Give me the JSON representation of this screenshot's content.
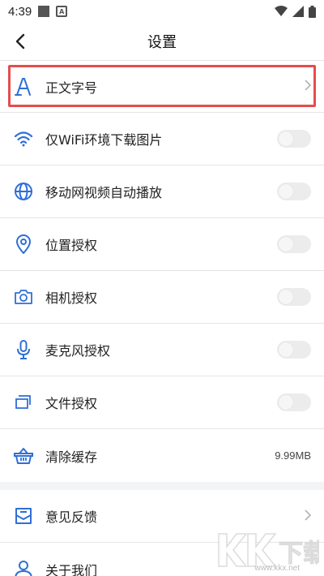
{
  "status_bar": {
    "time": "4:39",
    "app_icon_letter": "A",
    "icons": [
      "square-icon",
      "app-icon",
      "wifi-icon",
      "signal-icon",
      "battery-icon"
    ]
  },
  "nav": {
    "title": "设置"
  },
  "settings": [
    {
      "label": "正文字号",
      "icon": "font-size-icon",
      "control": "chevron"
    },
    {
      "label": "仅WiFi环境下载图片",
      "icon": "wifi-icon",
      "control": "toggle",
      "on": false
    },
    {
      "label": "移动网视频自动播放",
      "icon": "globe-icon",
      "control": "toggle",
      "on": false
    },
    {
      "label": "位置授权",
      "icon": "location-pin-icon",
      "control": "toggle",
      "on": false
    },
    {
      "label": "相机授权",
      "icon": "camera-icon",
      "control": "toggle",
      "on": false
    },
    {
      "label": "麦克风授权",
      "icon": "microphone-icon",
      "control": "toggle",
      "on": false
    },
    {
      "label": "文件授权",
      "icon": "folder-icon",
      "control": "toggle",
      "on": false
    },
    {
      "label": "清除缓存",
      "icon": "basket-icon",
      "control": "value",
      "value": "9.99MB"
    }
  ],
  "settings_secondary": [
    {
      "label": "意见反馈",
      "icon": "feedback-mail-icon",
      "control": "chevron"
    },
    {
      "label": "关于我们",
      "icon": "user-icon",
      "control": "none"
    }
  ],
  "watermark": {
    "text": "KK下载",
    "url": "www.kkx.net"
  },
  "colors": {
    "icon_blue": "#2f6fd6",
    "highlight_red": "#e64c4c",
    "divider": "#e5e5e5",
    "toggle_off": "#ececec"
  }
}
